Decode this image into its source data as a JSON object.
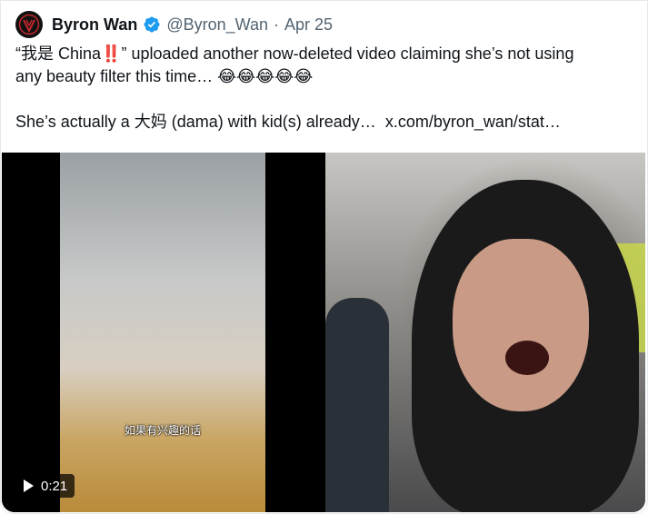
{
  "tweet": {
    "author_name": "Byron Wan",
    "handle": "@Byron_Wan",
    "separator": "·",
    "date": "Apr 25",
    "text_line1_prefix": "“我是 China",
    "text_line1_bangs": "‼️",
    "text_line1_suffix": "” uploaded another now-deleted video claiming she’s not using",
    "text_line2": "any beauty filter this time…",
    "text_line2_emojis": "😂😂😂😂😂",
    "text_line3": "She’s actually a 大妈 (dama) with kid(s) already…",
    "link": "x.com/byron_wan/stat…"
  },
  "media": {
    "video_subtitle": "如果有兴趣的话",
    "video_duration": "0:21"
  },
  "colors": {
    "verified_blue": "#1d9bf0",
    "secondary_text": "#536471",
    "avatar_logo_red": "#c0282d"
  }
}
